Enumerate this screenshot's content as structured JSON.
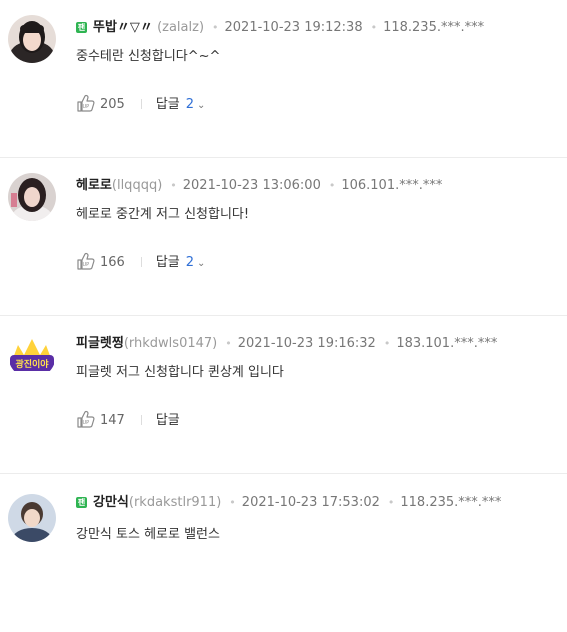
{
  "comments": [
    {
      "fan_badge": "팬",
      "nickname": "뚜밥〃▽〃",
      "user_id": "(zalalz)",
      "date": "2021-10-23 19:12:38",
      "ip": "118.235.***.***",
      "text": "중수테란 신청합니다^~^",
      "likes": "205",
      "reply_label": "답글",
      "reply_count": "2"
    },
    {
      "nickname": "헤로로",
      "user_id": "(llqqqq)",
      "date": "2021-10-23 13:06:00",
      "ip": "106.101.***.***",
      "text": "헤로로 중간계 저그 신청합니다!",
      "likes": "166",
      "reply_label": "답글",
      "reply_count": "2"
    },
    {
      "avatar_text": "광진이야",
      "nickname": "피글렛찡",
      "user_id": "(rhkdwls0147)",
      "date": "2021-10-23 19:16:32",
      "ip": "183.101.***.***",
      "text": "피글렛 저그 신청합니다 퀸상계 입니다",
      "likes": "147",
      "reply_label": "답글"
    },
    {
      "fan_badge": "팬",
      "nickname": "강만식",
      "user_id": "(rkdakstlr911)",
      "date": "2021-10-23 17:53:02",
      "ip": "118.235.***.***",
      "text": "강만식 토스 헤로로 밸런스"
    }
  ],
  "icons": {
    "like": "thumbs-up-icon",
    "reply_toggle": "chevron-down-icon",
    "badge": "fan-badge"
  },
  "colors": {
    "fan_badge": "#2fb452",
    "reply_count": "#2f6fd6",
    "divider": "#ececec"
  }
}
